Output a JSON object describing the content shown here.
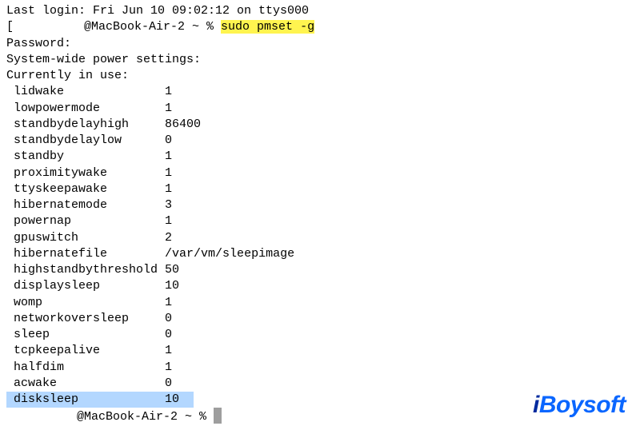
{
  "header": {
    "last_login": "Last login: Fri Jun 10 09:02:12 on ttys000",
    "prompt_prefix": "[",
    "hostname": "@MacBook-Air-2 ~ % ",
    "command": "sudo pmset -g",
    "password_prompt": "Password:",
    "heading": "System-wide power settings:",
    "subheading": "Currently in use:"
  },
  "settings": [
    {
      "key": "lidwake",
      "value": "1"
    },
    {
      "key": "lowpowermode",
      "value": "1"
    },
    {
      "key": "standbydelayhigh",
      "value": "86400"
    },
    {
      "key": "standbydelaylow",
      "value": "0"
    },
    {
      "key": "standby",
      "value": "1"
    },
    {
      "key": "proximitywake",
      "value": "1"
    },
    {
      "key": "ttyskeepawake",
      "value": "1"
    },
    {
      "key": "hibernatemode",
      "value": "3"
    },
    {
      "key": "powernap",
      "value": "1"
    },
    {
      "key": "gpuswitch",
      "value": "2"
    },
    {
      "key": "hibernatefile",
      "value": "/var/vm/sleepimage"
    },
    {
      "key": "highstandbythreshold",
      "value": "50"
    },
    {
      "key": "displaysleep",
      "value": "10"
    },
    {
      "key": "womp",
      "value": "1"
    },
    {
      "key": "networkoversleep",
      "value": "0"
    },
    {
      "key": "sleep",
      "value": "0"
    },
    {
      "key": "tcpkeepalive",
      "value": "1"
    },
    {
      "key": "halfdim",
      "value": "1"
    },
    {
      "key": "acwake",
      "value": "0"
    },
    {
      "key": "disksleep",
      "value": "10",
      "highlight": true
    }
  ],
  "footer": {
    "hostname": "@MacBook-Air-2 ~ % "
  },
  "watermark": {
    "prefix": "i",
    "suffix": "Boysoft"
  }
}
